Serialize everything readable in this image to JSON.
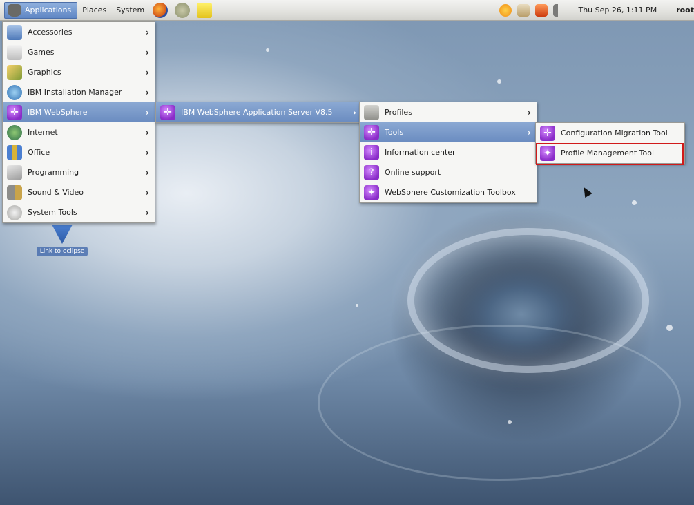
{
  "panel": {
    "applications_label": "Applications",
    "places_label": "Places",
    "system_label": "System",
    "clock": "Thu Sep 26,  1:11 PM",
    "user": "root",
    "launchers": [
      "firefox-icon",
      "network-icon",
      "notes-icon"
    ],
    "tray": [
      "update-icon",
      "package-icon",
      "alert-icon",
      "volume-icon"
    ]
  },
  "menu_l1": {
    "items": [
      {
        "label": "Accessories",
        "icon": "accessories-icon"
      },
      {
        "label": "Games",
        "icon": "games-icon"
      },
      {
        "label": "Graphics",
        "icon": "graphics-icon"
      },
      {
        "label": "IBM Installation Manager",
        "icon": "ibm-installation-manager-icon"
      },
      {
        "label": "IBM WebSphere",
        "icon": "websphere-icon"
      },
      {
        "label": "Internet",
        "icon": "internet-icon"
      },
      {
        "label": "Office",
        "icon": "office-icon"
      },
      {
        "label": "Programming",
        "icon": "programming-icon"
      },
      {
        "label": "Sound & Video",
        "icon": "sound-video-icon"
      },
      {
        "label": "System Tools",
        "icon": "system-tools-icon"
      }
    ]
  },
  "menu_l2": {
    "items": [
      {
        "label": "IBM WebSphere Application Server V8.5",
        "icon": "websphere-icon"
      }
    ]
  },
  "menu_l3": {
    "items": [
      {
        "label": "Profiles",
        "icon": "folder-icon"
      },
      {
        "label": "Tools",
        "icon": "websphere-icon"
      },
      {
        "label": "Information center",
        "icon": "info-icon"
      },
      {
        "label": "Online support",
        "icon": "support-icon"
      },
      {
        "label": "WebSphere Customization Toolbox",
        "icon": "toolbox-icon"
      }
    ]
  },
  "menu_l4": {
    "items": [
      {
        "label": "Configuration Migration Tool",
        "icon": "websphere-icon"
      },
      {
        "label": "Profile Management Tool",
        "icon": "profile-management-icon"
      }
    ]
  },
  "desktop_icon": {
    "label": "Link to eclipse"
  },
  "colors": {
    "menu_highlight": "#6a8cc0",
    "callout_border": "#d11a1a",
    "websphere_purple": "#8a2cc8"
  }
}
